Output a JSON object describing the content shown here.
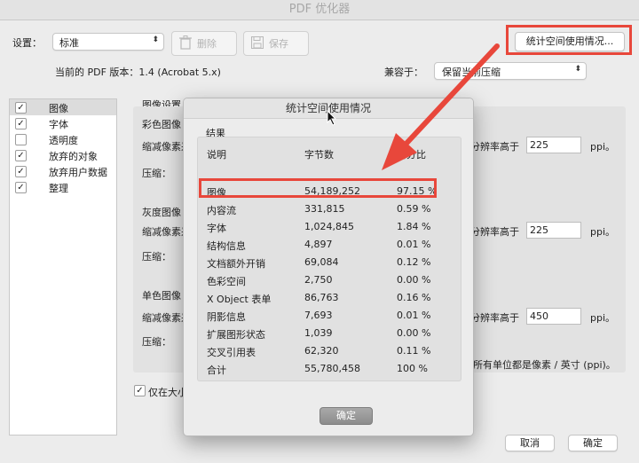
{
  "window": {
    "title": "PDF 优化器"
  },
  "toolbar": {
    "settings_label": "设置：",
    "preset_value": "标准",
    "delete_label": "删除",
    "save_label": "保存",
    "audit_button_label": "统计空间使用情况..."
  },
  "version_row": {
    "current_version": "当前的 PDF 版本：1.4 (Acrobat 5.x)",
    "compat_label": "兼容于：",
    "compat_value": "保留当前压缩"
  },
  "sidebar": {
    "items": [
      {
        "label": "图像",
        "checked": "✓"
      },
      {
        "label": "字体",
        "checked": "✓"
      },
      {
        "label": "透明度",
        "checked": ""
      },
      {
        "label": "放弃的对象",
        "checked": "✓"
      },
      {
        "label": "放弃用户数据",
        "checked": "✓"
      },
      {
        "label": "整理",
        "checked": "✓"
      }
    ]
  },
  "image_settings": {
    "section_title": "图像设置",
    "color_title": "彩色图像",
    "gray_title": "灰度图像",
    "mono_title": "单色图像",
    "downsample_label": "缩减像素采样",
    "compress_label": "压缩：",
    "above_label": "分辨率高于",
    "ppi_unit": "ppi。",
    "color_ppi": "225",
    "gray_ppi": "225",
    "mono_ppi": "450",
    "units_note": "所有单位都是像素 / 英寸 (ppi)。",
    "optimize_checkbox_label": "仅在大小"
  },
  "dialog": {
    "title": "统计空间使用情况",
    "results_label": "结果",
    "columns": [
      "说明",
      "字节数",
      "百分比"
    ],
    "rows": [
      [
        "图像",
        "54,189,252",
        "97.15 %"
      ],
      [
        "内容流",
        "331,815",
        "0.59 %"
      ],
      [
        "字体",
        "1,024,845",
        "1.84 %"
      ],
      [
        "结构信息",
        "4,897",
        "0.01 %"
      ],
      [
        "文档额外开销",
        "69,084",
        "0.12 %"
      ],
      [
        "色彩空间",
        "2,750",
        "0.00 %"
      ],
      [
        "X Object 表单",
        "86,763",
        "0.16 %"
      ],
      [
        "阴影信息",
        "7,693",
        "0.01 %"
      ],
      [
        "扩展图形状态",
        "1,039",
        "0.00 %"
      ],
      [
        "交叉引用表",
        "62,320",
        "0.11 %"
      ],
      [
        "合计",
        "55,780,458",
        "100 %"
      ]
    ],
    "ok_label": "确定"
  },
  "footer": {
    "cancel_label": "取消",
    "ok_label": "确定"
  },
  "colors": {
    "annotation_red": "#e8473b"
  }
}
